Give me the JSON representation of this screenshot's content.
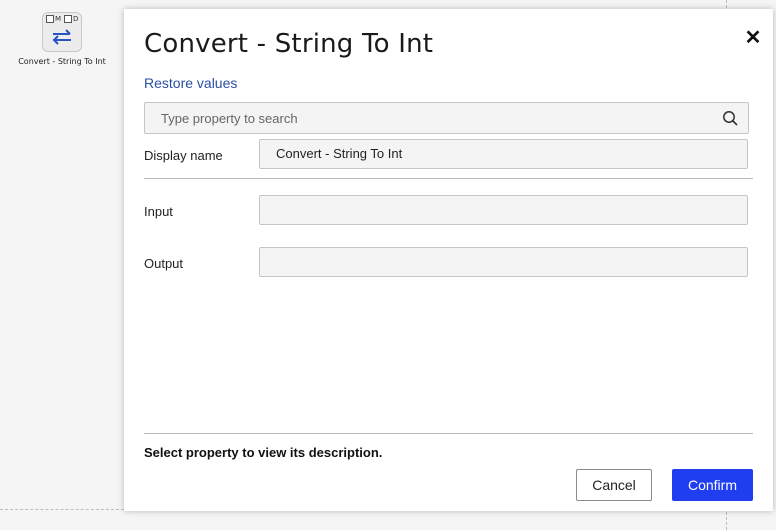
{
  "canvas": {
    "node": {
      "flag_m": "M",
      "flag_d": "D",
      "label": "Convert - String To Int",
      "icon": "swap-arrows-icon"
    }
  },
  "dialog": {
    "title": "Convert - String To Int",
    "close_icon": "close-icon",
    "restore_label": "Restore values",
    "search": {
      "placeholder": "Type property to search",
      "icon": "search-icon"
    },
    "fields": {
      "display_name": {
        "label": "Display name",
        "value": "Convert - String To Int"
      },
      "input": {
        "label": "Input",
        "value": ""
      },
      "output": {
        "label": "Output",
        "value": ""
      }
    },
    "description": "Select property to view its description.",
    "cancel_label": "Cancel",
    "confirm_label": "Confirm"
  },
  "colors": {
    "accent": "#1f3ef0",
    "link": "#2b4ea2",
    "node_icon": "#2952c8"
  }
}
